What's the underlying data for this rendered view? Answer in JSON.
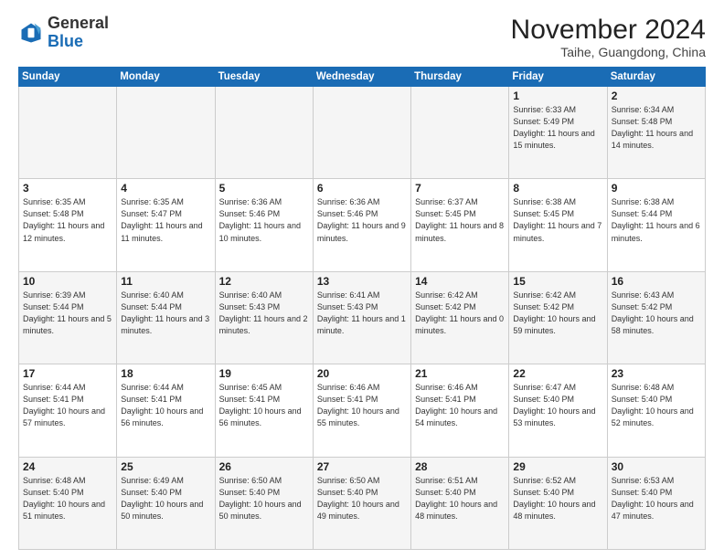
{
  "header": {
    "logo": {
      "general": "General",
      "blue": "Blue"
    },
    "title": "November 2024",
    "subtitle": "Taihe, Guangdong, China"
  },
  "columns": [
    "Sunday",
    "Monday",
    "Tuesday",
    "Wednesday",
    "Thursday",
    "Friday",
    "Saturday"
  ],
  "weeks": [
    [
      {
        "day": "",
        "info": ""
      },
      {
        "day": "",
        "info": ""
      },
      {
        "day": "",
        "info": ""
      },
      {
        "day": "",
        "info": ""
      },
      {
        "day": "",
        "info": ""
      },
      {
        "day": "1",
        "info": "Sunrise: 6:33 AM\nSunset: 5:49 PM\nDaylight: 11 hours\nand 15 minutes."
      },
      {
        "day": "2",
        "info": "Sunrise: 6:34 AM\nSunset: 5:48 PM\nDaylight: 11 hours\nand 14 minutes."
      }
    ],
    [
      {
        "day": "3",
        "info": "Sunrise: 6:35 AM\nSunset: 5:48 PM\nDaylight: 11 hours\nand 12 minutes."
      },
      {
        "day": "4",
        "info": "Sunrise: 6:35 AM\nSunset: 5:47 PM\nDaylight: 11 hours\nand 11 minutes."
      },
      {
        "day": "5",
        "info": "Sunrise: 6:36 AM\nSunset: 5:46 PM\nDaylight: 11 hours\nand 10 minutes."
      },
      {
        "day": "6",
        "info": "Sunrise: 6:36 AM\nSunset: 5:46 PM\nDaylight: 11 hours\nand 9 minutes."
      },
      {
        "day": "7",
        "info": "Sunrise: 6:37 AM\nSunset: 5:45 PM\nDaylight: 11 hours\nand 8 minutes."
      },
      {
        "day": "8",
        "info": "Sunrise: 6:38 AM\nSunset: 5:45 PM\nDaylight: 11 hours\nand 7 minutes."
      },
      {
        "day": "9",
        "info": "Sunrise: 6:38 AM\nSunset: 5:44 PM\nDaylight: 11 hours\nand 6 minutes."
      }
    ],
    [
      {
        "day": "10",
        "info": "Sunrise: 6:39 AM\nSunset: 5:44 PM\nDaylight: 11 hours\nand 5 minutes."
      },
      {
        "day": "11",
        "info": "Sunrise: 6:40 AM\nSunset: 5:44 PM\nDaylight: 11 hours\nand 3 minutes."
      },
      {
        "day": "12",
        "info": "Sunrise: 6:40 AM\nSunset: 5:43 PM\nDaylight: 11 hours\nand 2 minutes."
      },
      {
        "day": "13",
        "info": "Sunrise: 6:41 AM\nSunset: 5:43 PM\nDaylight: 11 hours\nand 1 minute."
      },
      {
        "day": "14",
        "info": "Sunrise: 6:42 AM\nSunset: 5:42 PM\nDaylight: 11 hours\nand 0 minutes."
      },
      {
        "day": "15",
        "info": "Sunrise: 6:42 AM\nSunset: 5:42 PM\nDaylight: 10 hours\nand 59 minutes."
      },
      {
        "day": "16",
        "info": "Sunrise: 6:43 AM\nSunset: 5:42 PM\nDaylight: 10 hours\nand 58 minutes."
      }
    ],
    [
      {
        "day": "17",
        "info": "Sunrise: 6:44 AM\nSunset: 5:41 PM\nDaylight: 10 hours\nand 57 minutes."
      },
      {
        "day": "18",
        "info": "Sunrise: 6:44 AM\nSunset: 5:41 PM\nDaylight: 10 hours\nand 56 minutes."
      },
      {
        "day": "19",
        "info": "Sunrise: 6:45 AM\nSunset: 5:41 PM\nDaylight: 10 hours\nand 56 minutes."
      },
      {
        "day": "20",
        "info": "Sunrise: 6:46 AM\nSunset: 5:41 PM\nDaylight: 10 hours\nand 55 minutes."
      },
      {
        "day": "21",
        "info": "Sunrise: 6:46 AM\nSunset: 5:41 PM\nDaylight: 10 hours\nand 54 minutes."
      },
      {
        "day": "22",
        "info": "Sunrise: 6:47 AM\nSunset: 5:40 PM\nDaylight: 10 hours\nand 53 minutes."
      },
      {
        "day": "23",
        "info": "Sunrise: 6:48 AM\nSunset: 5:40 PM\nDaylight: 10 hours\nand 52 minutes."
      }
    ],
    [
      {
        "day": "24",
        "info": "Sunrise: 6:48 AM\nSunset: 5:40 PM\nDaylight: 10 hours\nand 51 minutes."
      },
      {
        "day": "25",
        "info": "Sunrise: 6:49 AM\nSunset: 5:40 PM\nDaylight: 10 hours\nand 50 minutes."
      },
      {
        "day": "26",
        "info": "Sunrise: 6:50 AM\nSunset: 5:40 PM\nDaylight: 10 hours\nand 50 minutes."
      },
      {
        "day": "27",
        "info": "Sunrise: 6:50 AM\nSunset: 5:40 PM\nDaylight: 10 hours\nand 49 minutes."
      },
      {
        "day": "28",
        "info": "Sunrise: 6:51 AM\nSunset: 5:40 PM\nDaylight: 10 hours\nand 48 minutes."
      },
      {
        "day": "29",
        "info": "Sunrise: 6:52 AM\nSunset: 5:40 PM\nDaylight: 10 hours\nand 48 minutes."
      },
      {
        "day": "30",
        "info": "Sunrise: 6:53 AM\nSunset: 5:40 PM\nDaylight: 10 hours\nand 47 minutes."
      }
    ]
  ]
}
